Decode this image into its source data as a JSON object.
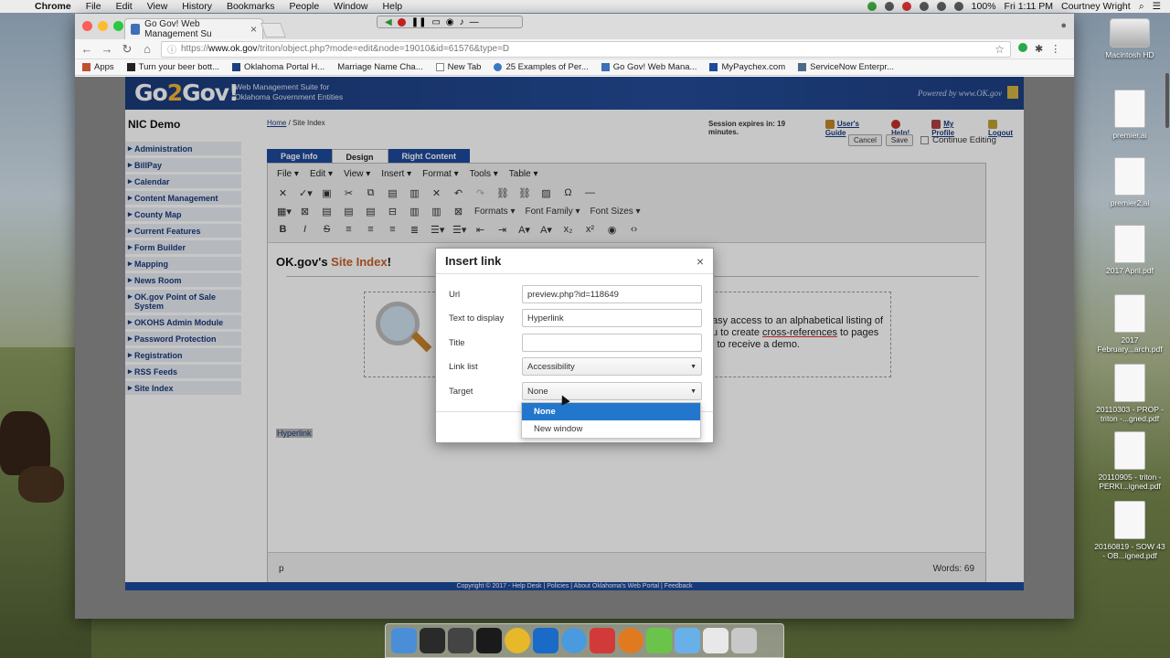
{
  "menubar": {
    "app": "Chrome",
    "items": [
      "File",
      "Edit",
      "View",
      "History",
      "Bookmarks",
      "People",
      "Window",
      "Help"
    ],
    "battery": "100%",
    "clock": "Fri 1:11 PM",
    "user": "Courtney Wright"
  },
  "browser": {
    "tab_title": "Go Gov! Web Management Su",
    "url_prefix": "https://",
    "url_domain": "www.ok.gov",
    "url_path": "/triton/object.php?mode=edit&node=19010&id=61576&type=D",
    "bookmarks": [
      "Apps",
      "Turn your beer bott...",
      "Oklahoma Portal H...",
      "Marriage Name Cha...",
      "New Tab",
      "25 Examples of Per...",
      "Go Gov! Web Mana...",
      "MyPaychex.com",
      "ServiceNow Enterpr..."
    ]
  },
  "site": {
    "logo_main": "Go",
    "logo_accent": "2",
    "logo_end": "Gov!",
    "tagline_1": "Web Management Suite for",
    "tagline_2": "Oklahoma Government Entities",
    "powered": "Powered by www.OK.gov",
    "sidebar_title": "NIC Demo",
    "sidebar_items": [
      "Administration",
      "BillPay",
      "Calendar",
      "Content Management",
      "County Map",
      "Current Features",
      "Form Builder",
      "Mapping",
      "News Room",
      "OK.gov Point of Sale System",
      "OKOHS Admin Module",
      "Password Protection",
      "Registration",
      "RSS Feeds",
      "Site Index"
    ],
    "breadcrumb_home": "Home",
    "breadcrumb_current": " / Site Index",
    "session_text": "Session expires in: 19 minutes.",
    "users_guide": "User's Guide",
    "help": "Help!",
    "my_profile": "My Profile",
    "logout": "Logout",
    "cancel": "Cancel",
    "save": "Save",
    "continue_editing": "Continue Editing",
    "tabs": [
      "Page Info",
      "Design",
      "Right Content"
    ],
    "footer": "Copyright © 2017 - Help Desk | Policies | About Oklahoma's Web Portal | Feedback"
  },
  "editor": {
    "menus": [
      "File",
      "Edit",
      "View",
      "Insert",
      "Format",
      "Tools",
      "Table"
    ],
    "formats": "Formats",
    "font_family": "Font Family",
    "font_sizes": "Font Sizes",
    "heading_pre": "OK.gov's ",
    "heading_accent": "Site Index",
    "heading_post": "!",
    "body_line1": "asy access to an alphabetical listing of",
    "body_line2_pre": "u to create ",
    "body_line2_link": "cross-references",
    "body_line2_post": " to pages",
    "body_line3": "l to receive a demo.",
    "selected_text": "Hyperlink",
    "status_path": "p",
    "word_count": "Words: 69"
  },
  "dialog": {
    "title": "Insert link",
    "close": "×",
    "url_label": "Url",
    "url_value": "preview.php?id=118649",
    "text_label": "Text to display",
    "text_value": "Hyperlink",
    "title_label": "Title",
    "title_value": "",
    "linklist_label": "Link list",
    "linklist_value": "Accessibility",
    "target_label": "Target",
    "target_value": "None",
    "target_options": [
      "None",
      "New window"
    ]
  },
  "desktop_icons": [
    "Macintosh HD",
    "premier.ai",
    "premier2.ai",
    "2017 April.pdf",
    "2017 February...arch.pdf",
    "20110303 - PROP - triton -...gned.pdf",
    "20110905 - triton - PERKI...igned.pdf",
    "20160819 - SOW 43 - OB...igned.pdf"
  ]
}
